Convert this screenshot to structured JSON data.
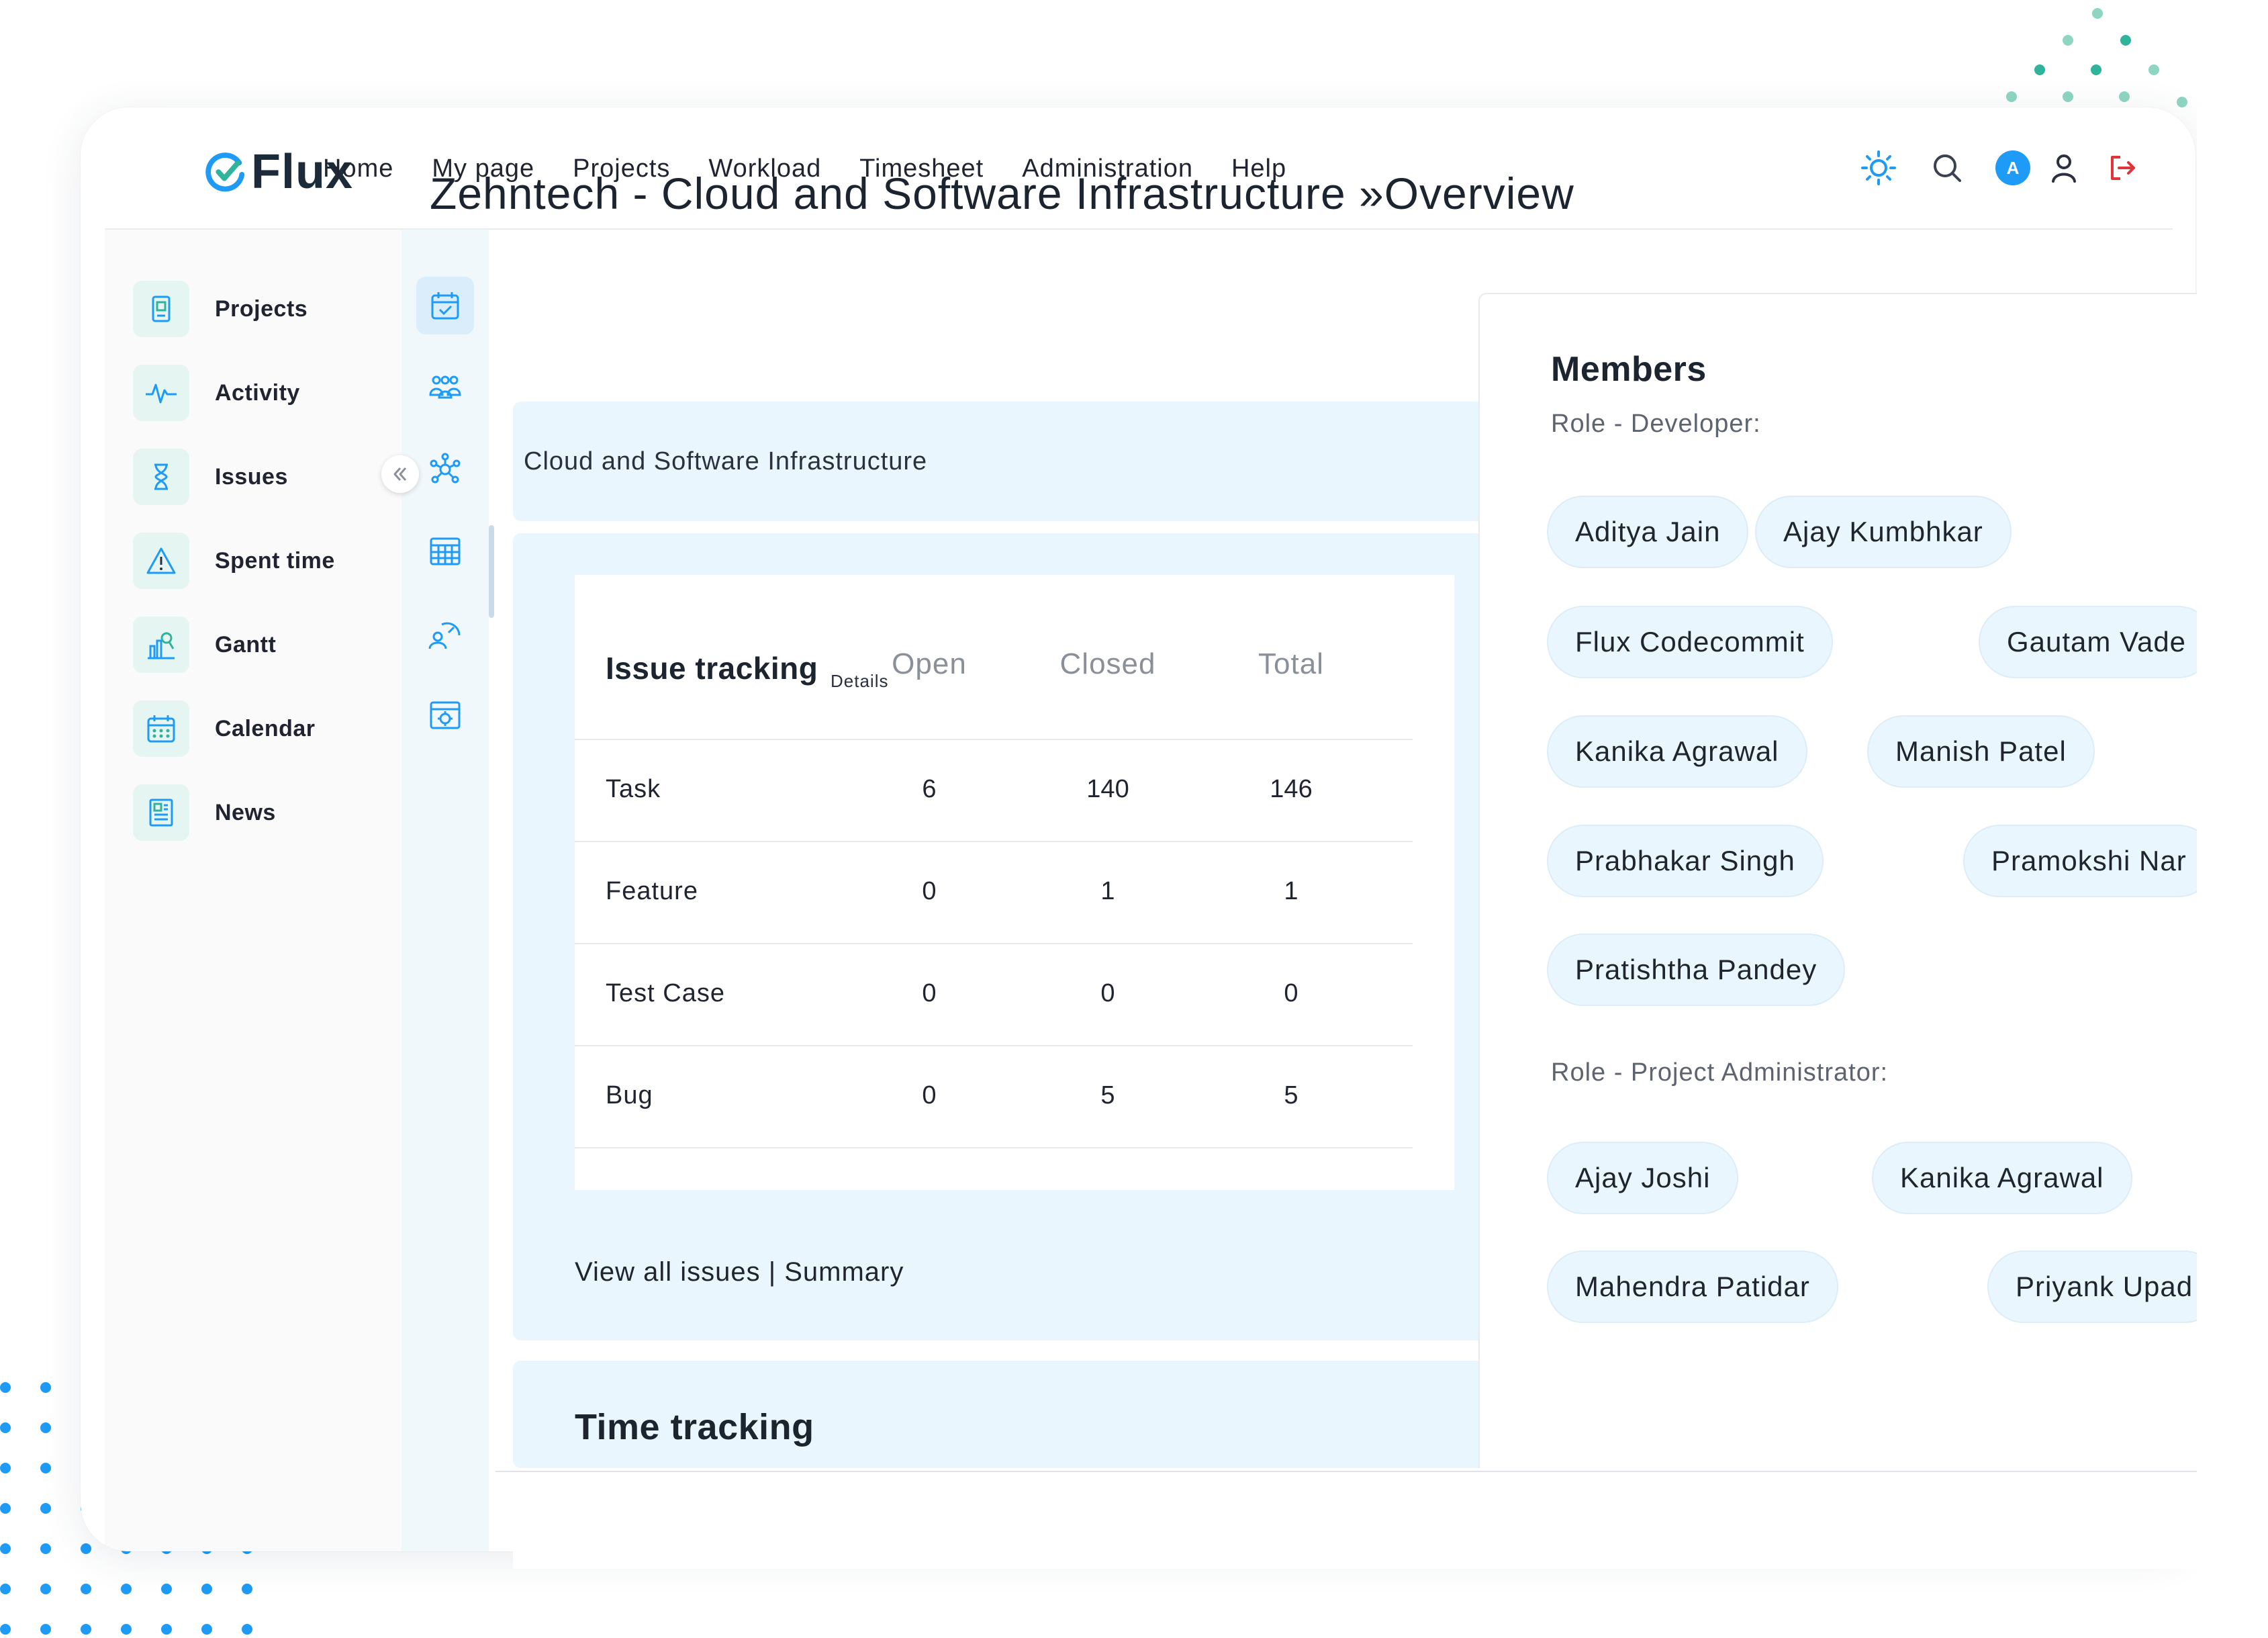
{
  "app": {
    "logo_text": "Flux"
  },
  "nav": {
    "items": [
      "Home",
      "My page",
      "Projects",
      "Workload",
      "Timesheet",
      "Administration",
      "Help"
    ]
  },
  "top_icons": {
    "theme": "sun-icon",
    "search": "search-icon",
    "avatar_letter": "A",
    "user": "user-icon",
    "logout": "logout-icon"
  },
  "sidebar": {
    "items": [
      {
        "label": "Projects",
        "icon": "projects-icon"
      },
      {
        "label": "Activity",
        "icon": "activity-icon"
      },
      {
        "label": "Issues",
        "icon": "hourglass-icon"
      },
      {
        "label": "Spent time",
        "icon": "warning-icon"
      },
      {
        "label": "Gantt",
        "icon": "gantt-icon"
      },
      {
        "label": "Calendar",
        "icon": "calendar-icon"
      },
      {
        "label": "News",
        "icon": "news-icon"
      }
    ]
  },
  "rail": {
    "icons": [
      "calendar-check-icon",
      "team-icon",
      "network-icon",
      "table-icon",
      "dashboard-user-icon",
      "settings-grid-icon"
    ]
  },
  "page": {
    "title": "Zehntech - Cloud and Software Infrastructure »Overview",
    "description": "Cloud and Software Infrastructure"
  },
  "issue_tracking": {
    "title": "Issue tracking",
    "details_link": "Details",
    "columns": [
      "Open",
      "Closed",
      "Total"
    ],
    "rows": [
      {
        "name": "Task",
        "open": "6",
        "closed": "140",
        "total": "146"
      },
      {
        "name": "Feature",
        "open": "0",
        "closed": "1",
        "total": "1"
      },
      {
        "name": "Test Case",
        "open": "0",
        "closed": "0",
        "total": "0"
      },
      {
        "name": "Bug",
        "open": "0",
        "closed": "5",
        "total": "5"
      }
    ],
    "view_all_link": "View all issues",
    "separator": " | ",
    "summary_link": "Summary"
  },
  "time_tracking": {
    "title": "Time tracking"
  },
  "members": {
    "title": "Members",
    "roles": [
      {
        "label": "Role - Developer:",
        "members": [
          "Aditya Jain",
          "Ajay Kumbhkar",
          "Flux Codecommit",
          "Gautam Vade",
          "Kanika Agrawal",
          "Manish Patel",
          "Prabhakar Singh",
          "Pramokshi Nar",
          "Pratishtha Pandey"
        ]
      },
      {
        "label": "Role - Project Administrator:",
        "members": [
          "Ajay Joshi",
          "Kanika Agrawal",
          "Mahendra Patidar",
          "Priyank Upad"
        ]
      }
    ]
  },
  "colors": {
    "accent_blue": "#1e9af7",
    "teal": "#2fb39a",
    "panel_bg": "#eaf6fd",
    "logout_red": "#e2333a"
  }
}
